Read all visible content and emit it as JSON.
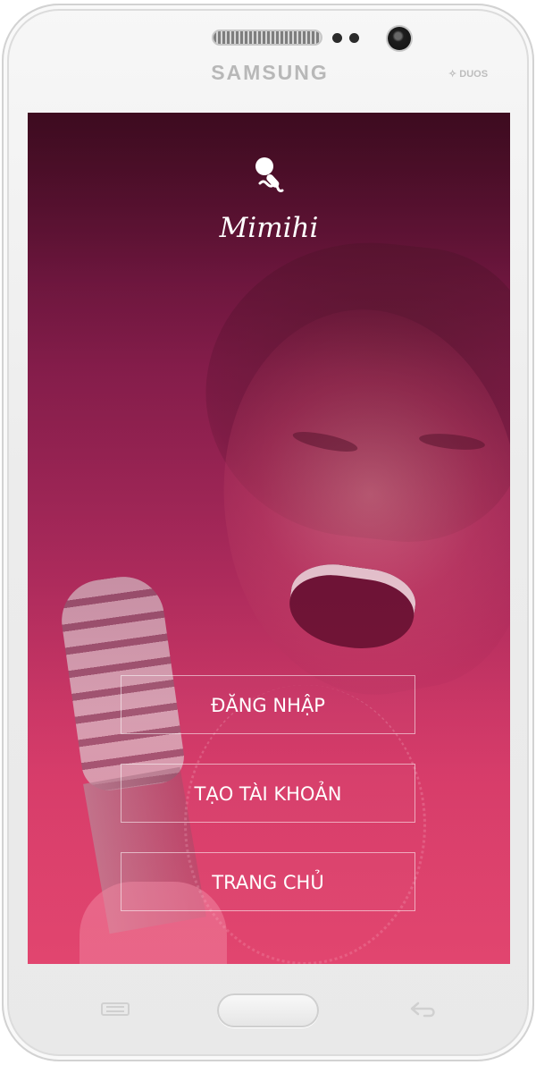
{
  "device": {
    "brand": "SAMSUNG",
    "model_badge": "DUOS"
  },
  "app": {
    "name": "Mimihi"
  },
  "buttons": {
    "login": "ĐĂNG NHẬP",
    "create_account": "TẠO TÀI KHOẢN",
    "home": "TRANG CHỦ"
  },
  "colors": {
    "accent": "#d93d6b",
    "overlay_top": "#3f1025",
    "overlay_bottom": "#de446f",
    "text": "#ffffff"
  },
  "icons": {
    "logo": "microphone-icon",
    "menu_key": "menu-icon",
    "back_key": "back-icon"
  }
}
